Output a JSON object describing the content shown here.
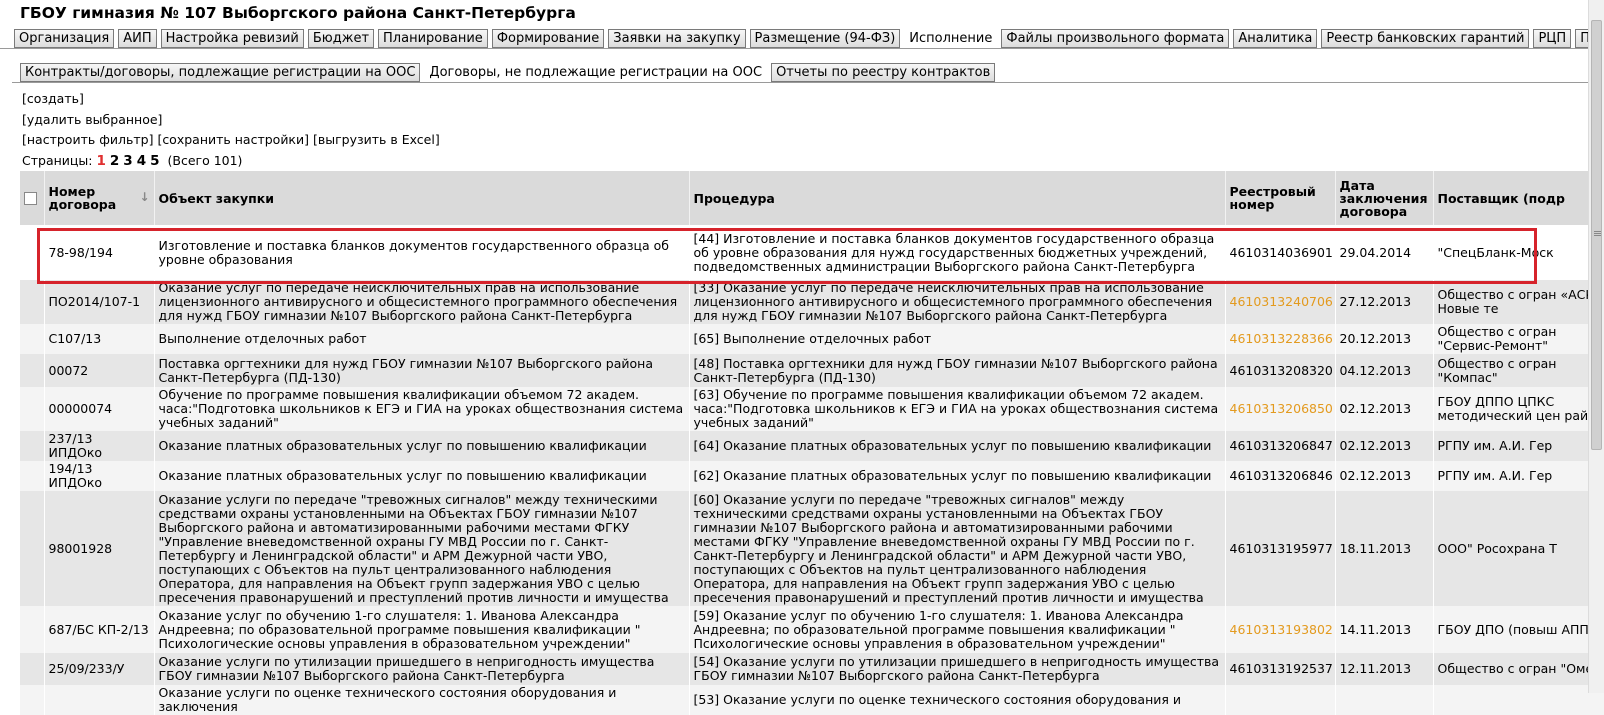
{
  "header": {
    "title": "ГБОУ гимназия № 107 Выборгского района Санкт-Петербурга"
  },
  "main_tabs": [
    {
      "label": "Организация"
    },
    {
      "label": "АИП"
    },
    {
      "label": "Настройка ревизий"
    },
    {
      "label": "Бюджет"
    },
    {
      "label": "Планирование"
    },
    {
      "label": "Формирование"
    },
    {
      "label": "Заявки на закупку"
    },
    {
      "label": "Размещение (94-ФЗ)"
    },
    {
      "label": "Исполнение"
    },
    {
      "label": "Файлы произвольного формата"
    },
    {
      "label": "Аналитика"
    },
    {
      "label": "Реестр банковских гарантий"
    },
    {
      "label": "РЦП"
    },
    {
      "label": "Прочие доку"
    }
  ],
  "sub_tabs": [
    {
      "label": "Контракты/договоры, подлежащие регистрации на ООС"
    },
    {
      "label": "Договоры, не подлежащие регистрации на ООС"
    },
    {
      "label": "Отчеты по реестру контрактов"
    }
  ],
  "actions": {
    "create": "[создать]",
    "delete_selected": "[удалить выбранное]",
    "setup_filter": "[настроить фильтр]",
    "save_settings": "[сохранить настройки]",
    "export_excel": "[выгрузить в Excel]"
  },
  "pager": {
    "label": "Страницы:",
    "pages": [
      "1",
      "2",
      "3",
      "4",
      "5"
    ],
    "total": "(Всего 101)"
  },
  "table": {
    "headers": {
      "number": "Номер договора",
      "object": "Объект закупки",
      "procedure": "Процедура",
      "registry": "Реестровый номер",
      "date": "Дата заключения договора",
      "supplier": "Поставщик (подр"
    },
    "rows": [
      {
        "number": "78-98/194",
        "object": "Изготовление и поставка бланков документов государственного образца об уровне образования",
        "procedure": "[44] Изготовление и поставка бланков документов государственного образца об уровне образования для нужд государственных бюджетных учреждений, подведомственных администрации Выборгского района Санкт-Петербурга",
        "registry": "4610314036901",
        "registry_link": false,
        "date": "29.04.2014",
        "supplier": "\"СпецБланк-Моск"
      },
      {
        "number": "ПО2014/107-1",
        "object": "Оказание услуг по передаче неисключительных прав на использование лицензионного антивирусного и общесистемного программного обеспечения для нужд ГБОУ гимназии №107 Выборгского района Санкт-Петербурга",
        "procedure": "[33] Оказание услуг по передаче неисключительных прав на использование лицензионного антивирусного и общесистемного программного обеспечения для нужд ГБОУ гимназии №107 Выборгского района Санкт-Петербурга",
        "registry": "4610313240706",
        "registry_link": true,
        "date": "27.12.2013",
        "supplier": "Общество с огран «АСКОД Новые те"
      },
      {
        "number": "С107/13",
        "object": "Выполнение отделочных работ",
        "procedure": "[65] Выполнение отделочных работ",
        "registry": "4610313228366",
        "registry_link": true,
        "date": "20.12.2013",
        "supplier": "Общество с огран \"Сервис-Ремонт\""
      },
      {
        "number": "00072",
        "object": "Поставка оргтехники для нужд ГБОУ гимназии №107 Выборгского района Санкт-Петербурга (ПД-130)",
        "procedure": "[48] Поставка оргтехники для нужд ГБОУ гимназии №107 Выборгского района Санкт-Петербурга (ПД-130)",
        "registry": "4610313208320",
        "registry_link": false,
        "date": "04.12.2013",
        "supplier": "Общество с огран \"Компас\""
      },
      {
        "number": "00000074",
        "object": "Обучение по программе повышения квалификации объемом 72 академ. часа:\"Подготовка школьников к ЕГЭ и ГИА на уроках обществознания система учебных заданий\"",
        "procedure": "[63] Обучение по программе повышения квалификации объемом 72 академ. часа:\"Подготовка школьников к ЕГЭ и ГИА на уроках обществознания система учебных заданий\"",
        "registry": "4610313206850",
        "registry_link": true,
        "date": "02.12.2013",
        "supplier": "ГБОУ ДППО ЦПКС методический цен района"
      },
      {
        "number": "237/13 ИПДОко",
        "object": "Оказание платных образовательных услуг по повышению квалификации",
        "procedure": "[64] Оказание платных образовательных услуг по повышению квалификации",
        "registry": "4610313206847",
        "registry_link": false,
        "date": "02.12.2013",
        "supplier": "РГПУ им. А.И. Гер"
      },
      {
        "number": "194/13 ИПДОко",
        "object": "Оказание платных образовательных услуг по повышению квалификации",
        "procedure": "[62] Оказание платных образовательных услуг по повышению квалификации",
        "registry": "4610313206846",
        "registry_link": false,
        "date": "02.12.2013",
        "supplier": "РГПУ им. А.И. Гер"
      },
      {
        "number": "98001928",
        "object": "Оказание услуги по передаче \"тревожных сигналов\" между техническими средствами охраны установленными на Объектах ГБОУ гимназии №107 Выборгского района и автоматизированными рабочими местами ФГКУ \"Управление вневедомственной охраны ГУ МВД России по г. Санкт-Петербургу и Ленинградской области\" и АРМ Дежурной части УВО, поступающих с Объектов на пульт централизованного наблюдения Оператора, для направления на Объект групп задержания УВО с целью пресечения правонарушений и преступлений против личности и имущества",
        "procedure": "[60] Оказание услуги по передаче \"тревожных сигналов\" между техническими средствами охраны установленными на Объектах ГБОУ гимназии №107 Выборгского района и автоматизированными рабочими местами ФГКУ \"Управление вневедомственной охраны ГУ МВД России по г. Санкт-Петербургу и Ленинградской области\" и АРМ Дежурной части УВО, поступающих с Объектов на пульт централизованного наблюдения Оператора, для направления на Объект групп задержания УВО с целью пресечения правонарушений и преступлений против личности и имущества",
        "registry": "4610313195977",
        "registry_link": false,
        "date": "18.11.2013",
        "supplier": "ООО\" Росохрана Т"
      },
      {
        "number": "687/БС КП-2/13",
        "object": "Оказание услуг по обучению 1-го слушателя: 1. Иванова Александра Андреевна; по образовательной программе повышения квалификации \" Психологические основы управления в образовательном учреждении\"",
        "procedure": "[59] Оказание услуг по обучению 1-го слушателя: 1. Иванова Александра Андреевна; по образовательной программе повышения квалификации \" Психологические основы управления в образовательном учреждении\"",
        "registry": "4610313193802",
        "registry_link": true,
        "date": "14.11.2013",
        "supplier": "ГБОУ ДПО (повыш АППО"
      },
      {
        "number": "25/09/233/У",
        "object": "Оказание услуги по утилизации пришедшего в непригодность имущества ГБОУ гимназии №107 Выборгского района Санкт-Петербурга",
        "procedure": "[54] Оказание услуги по утилизации пришедшего в непригодность имущества ГБОУ гимназии №107 Выборгского района Санкт-Петербурга",
        "registry": "4610313192537",
        "registry_link": false,
        "date": "12.11.2013",
        "supplier": "Общество с огран \"Омега\""
      },
      {
        "number": "",
        "object": "Оказание услуги по оценке технического состояния оборудования и заключения",
        "procedure": "[53] Оказание услуги по оценке технического состояния оборудования и",
        "registry": "",
        "registry_link": false,
        "date": "",
        "supplier": ""
      }
    ]
  },
  "colors": {
    "highlight": "#d6232b",
    "link": "#e39a1e",
    "current_page": "#e03030"
  }
}
